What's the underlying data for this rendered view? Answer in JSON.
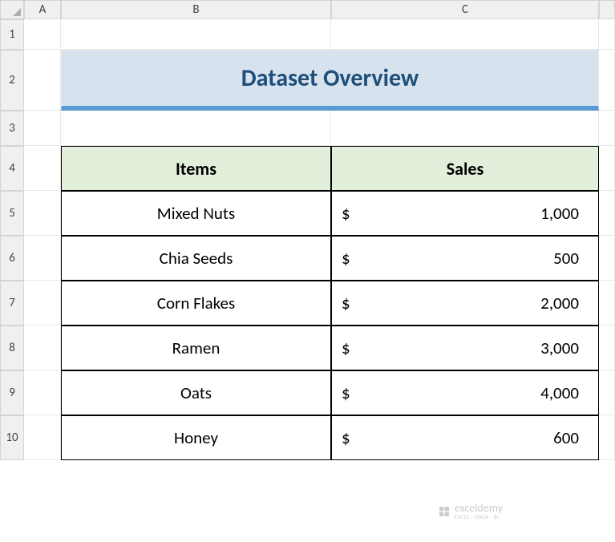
{
  "columns": [
    "A",
    "B",
    "C"
  ],
  "rows": [
    "1",
    "2",
    "3",
    "4",
    "5",
    "6",
    "7",
    "8",
    "9",
    "10"
  ],
  "title": "Dataset Overview",
  "table": {
    "headers": {
      "items": "Items",
      "sales": "Sales"
    },
    "currency": "$",
    "data": [
      {
        "item": "Mixed Nuts",
        "sales": "1,000"
      },
      {
        "item": "Chia Seeds",
        "sales": "500"
      },
      {
        "item": "Corn Flakes",
        "sales": "2,000"
      },
      {
        "item": "Ramen",
        "sales": "3,000"
      },
      {
        "item": "Oats",
        "sales": "4,000"
      },
      {
        "item": "Honey",
        "sales": "600"
      }
    ]
  },
  "watermark": {
    "name": "exceldemy",
    "tagline": "EXCEL · DATA · BI"
  },
  "chart_data": {
    "type": "table",
    "title": "Dataset Overview",
    "columns": [
      "Items",
      "Sales"
    ],
    "rows": [
      [
        "Mixed Nuts",
        1000
      ],
      [
        "Chia Seeds",
        500
      ],
      [
        "Corn Flakes",
        2000
      ],
      [
        "Ramen",
        3000
      ],
      [
        "Oats",
        4000
      ],
      [
        "Honey",
        600
      ]
    ]
  }
}
